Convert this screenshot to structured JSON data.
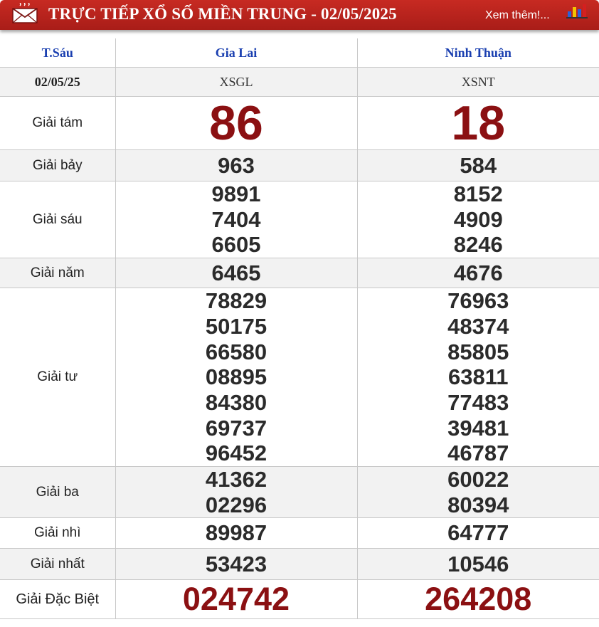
{
  "header": {
    "title": "TRỰC TIẾP XỔ SỐ MIỀN TRUNG - 02/05/2025",
    "more_label": "Xem thêm!...",
    "icons": [
      "mail-icon",
      "bar-chart-icon"
    ],
    "accent_color": "#b9231c",
    "number_color": "#8b1012",
    "column_head_color": "#1a3fb0"
  },
  "table": {
    "weekday": "T.Sáu",
    "date": "02/05/25",
    "provinces": [
      {
        "name": "Gia Lai",
        "code": "XSGL"
      },
      {
        "name": "Ninh Thuận",
        "code": "XSNT"
      }
    ],
    "prizes": [
      {
        "label": "Giải tám",
        "values": [
          [
            "86"
          ],
          [
            "18"
          ]
        ]
      },
      {
        "label": "Giải bảy",
        "values": [
          [
            "963"
          ],
          [
            "584"
          ]
        ]
      },
      {
        "label": "Giải sáu",
        "values": [
          [
            "9891",
            "7404",
            "6605"
          ],
          [
            "8152",
            "4909",
            "8246"
          ]
        ]
      },
      {
        "label": "Giải năm",
        "values": [
          [
            "6465"
          ],
          [
            "4676"
          ]
        ]
      },
      {
        "label": "Giải tư",
        "values": [
          [
            "78829",
            "50175",
            "66580",
            "08895",
            "84380",
            "69737",
            "96452"
          ],
          [
            "76963",
            "48374",
            "85805",
            "63811",
            "77483",
            "39481",
            "46787"
          ]
        ]
      },
      {
        "label": "Giải ba",
        "values": [
          [
            "41362",
            "02296"
          ],
          [
            "60022",
            "80394"
          ]
        ]
      },
      {
        "label": "Giải nhì",
        "values": [
          [
            "89987"
          ],
          [
            "64777"
          ]
        ]
      },
      {
        "label": "Giải nhất",
        "values": [
          [
            "53423"
          ],
          [
            "10546"
          ]
        ]
      },
      {
        "label": "Giải Đặc Biệt",
        "values": [
          [
            "024742"
          ],
          [
            "264208"
          ]
        ]
      }
    ]
  }
}
